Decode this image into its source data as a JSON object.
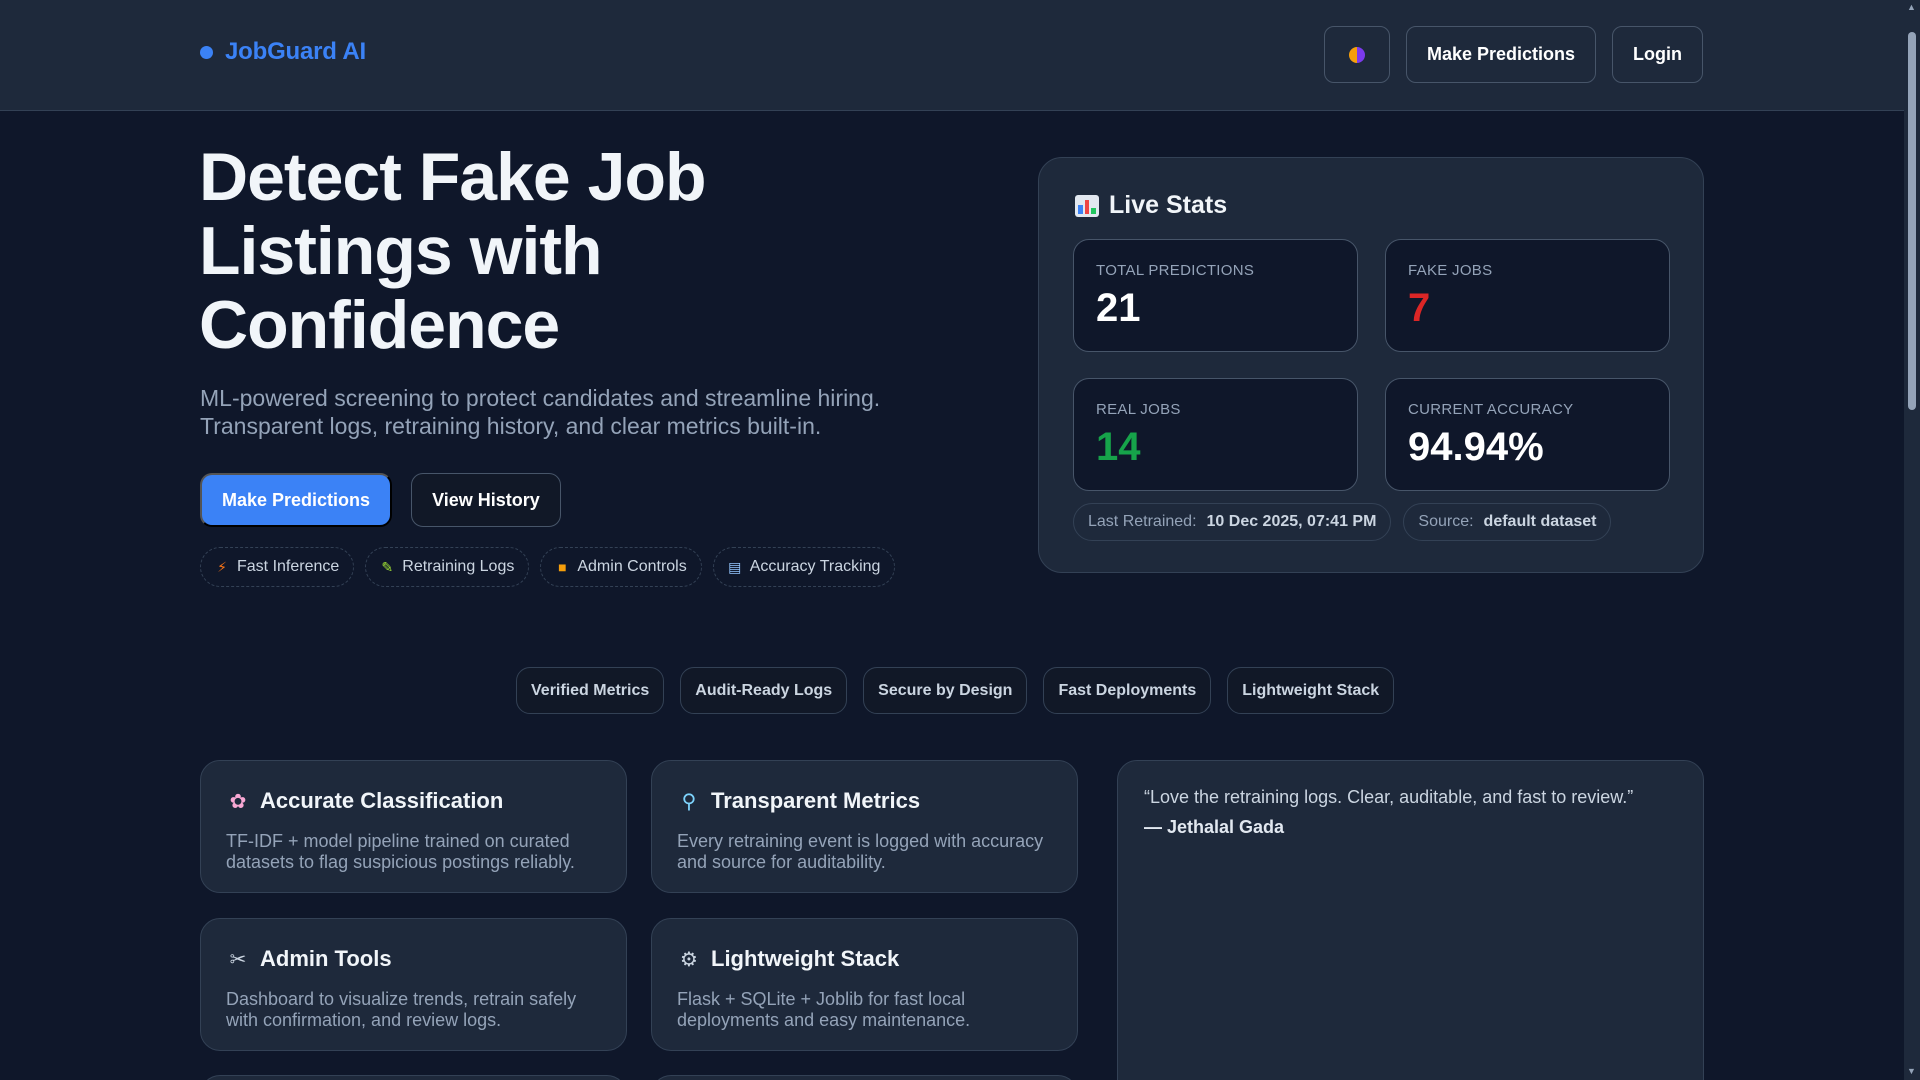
{
  "header": {
    "brand": "JobGuard AI",
    "make_predictions": "Make Predictions",
    "login": "Login",
    "theme_icon": "theme-toggle-icon"
  },
  "hero": {
    "title": "Detect Fake Job Listings with Confidence",
    "subtitle": "ML-powered screening to protect candidates and streamline hiring. Transparent logs, retraining history, and clear metrics built-in.",
    "primary_cta": "Make Predictions",
    "secondary_cta": "View History",
    "chips": [
      {
        "icon": "lightning-icon",
        "label": "Fast Inference"
      },
      {
        "icon": "pencil-icon",
        "label": "Retraining Logs"
      },
      {
        "icon": "lock-icon",
        "label": "Admin Controls"
      },
      {
        "icon": "chart-icon",
        "label": "Accuracy Tracking"
      }
    ]
  },
  "stats": {
    "title": "Live Stats",
    "cards": [
      {
        "label": "TOTAL PREDICTIONS",
        "value": "21",
        "color": "#ffffff"
      },
      {
        "label": "FAKE JOBS",
        "value": "7",
        "color": "#dc2626"
      },
      {
        "label": "REAL JOBS",
        "value": "14",
        "color": "#16a34a"
      },
      {
        "label": "CURRENT ACCURACY",
        "value": "94.94%",
        "color": "#ffffff"
      }
    ],
    "last_retrained_label": "Last Retrained:",
    "last_retrained_value": "10 Dec 2025, 07:41 PM",
    "source_label": "Source:",
    "source_value": "default dataset"
  },
  "badges": [
    "Verified Metrics",
    "Audit-Ready Logs",
    "Secure by Design",
    "Fast Deployments",
    "Lightweight Stack"
  ],
  "features": [
    {
      "icon": "brain-icon",
      "title": "Accurate Classification",
      "desc": "TF-IDF + model pipeline trained on curated datasets to flag suspicious postings reliably."
    },
    {
      "icon": "magnifier-icon",
      "title": "Transparent Metrics",
      "desc": "Every retraining event is logged with accuracy and source for auditability."
    },
    {
      "icon": "tools-icon",
      "title": "Admin Tools",
      "desc": "Dashboard to visualize trends, retrain safely with confirmation, and review logs."
    },
    {
      "icon": "gear-icon",
      "title": "Lightweight Stack",
      "desc": "Flask + SQLite + Joblib for fast local deployments and easy maintenance."
    }
  ],
  "testimonial": {
    "quote": "“Love the retraining logs. Clear, auditable, and fast to review.”",
    "author": "— Jethalal Gada"
  },
  "colors": {
    "background": "#0f172a",
    "surface": "#1e293b",
    "accent": "#3b82f6",
    "fake": "#dc2626",
    "real": "#16a34a"
  }
}
